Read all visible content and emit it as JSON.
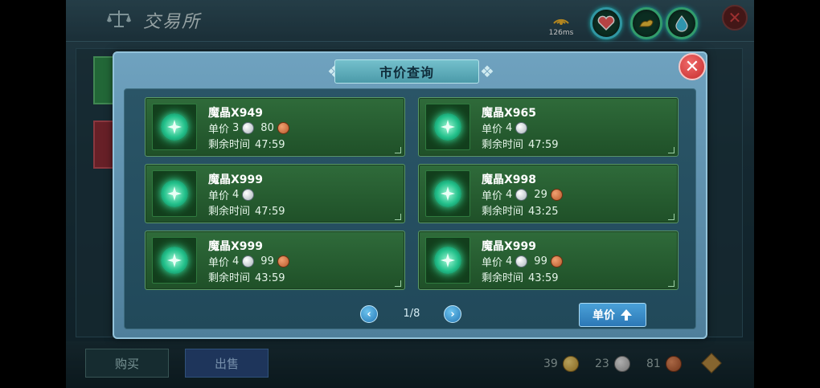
{
  "header": {
    "title": "交易所",
    "signal_ms": "126ms"
  },
  "bottom": {
    "buy_label": "购买",
    "sell_label": "出售",
    "gold": "39",
    "silver": "23",
    "copper": "81"
  },
  "modal": {
    "title": "市价查询",
    "close_icon": "close-icon",
    "price_label": "单价",
    "time_label": "剩余时间",
    "cards": [
      {
        "name": "魔晶X949",
        "silver": "3",
        "copper": "80",
        "time": "47:59"
      },
      {
        "name": "魔晶X965",
        "silver": "4",
        "copper": "",
        "time": "47:59"
      },
      {
        "name": "魔晶X999",
        "silver": "4",
        "copper": "",
        "time": "47:59"
      },
      {
        "name": "魔晶X998",
        "silver": "4",
        "copper": "29",
        "time": "43:25"
      },
      {
        "name": "魔晶X999",
        "silver": "4",
        "copper": "99",
        "time": "43:59"
      },
      {
        "name": "魔晶X999",
        "silver": "4",
        "copper": "99",
        "time": "43:59"
      }
    ],
    "pager": {
      "page": "1/8"
    },
    "sort_button_label": "单价"
  },
  "colors": {
    "card_bg": "#2f6b3a",
    "modal_bg": "#6fa2bf",
    "accent_blue": "#2c78b6"
  }
}
